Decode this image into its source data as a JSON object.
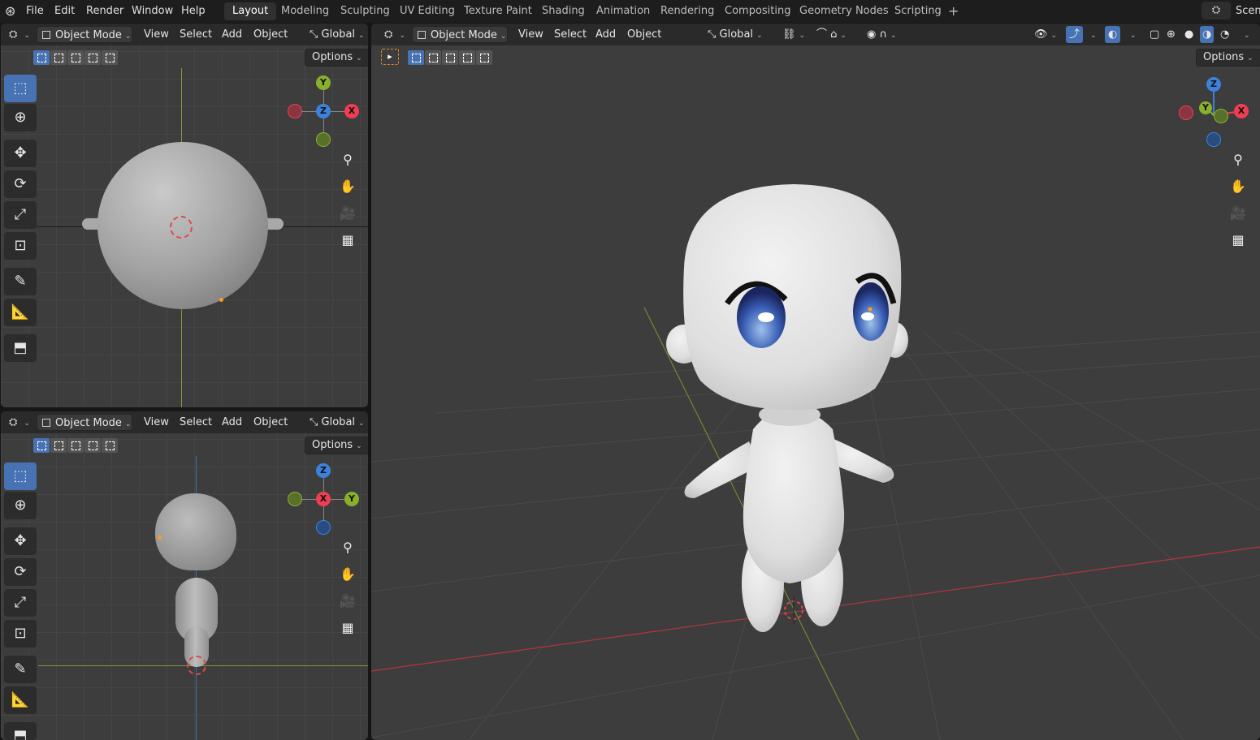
{
  "topbar": {
    "menus": [
      "File",
      "Edit",
      "Render",
      "Window",
      "Help"
    ],
    "workspaces": [
      "Layout",
      "Modeling",
      "Sculpting",
      "UV Editing",
      "Texture Paint",
      "Shading",
      "Animation",
      "Rendering",
      "Compositing",
      "Geometry Nodes",
      "Scripting"
    ],
    "active_workspace": "Layout",
    "add_tab": "+",
    "scene_label": "Scen"
  },
  "viewport_header": {
    "mode": "Object Mode",
    "menus": [
      "View",
      "Select",
      "Add",
      "Object"
    ],
    "orientation": "Global",
    "options": "Options"
  },
  "views": {
    "top_left": {
      "axes": {
        "y": "Y",
        "z": "Z",
        "x": "X"
      }
    },
    "bottom_left": {
      "axes": {
        "z": "Z",
        "x": "X",
        "y": "Y"
      }
    },
    "main": {
      "axes": {
        "z": "Z",
        "y": "Y",
        "x": "X"
      }
    }
  },
  "colors": {
    "accent_blue": "#4772b3",
    "axis_x": "#ee3f52",
    "axis_y": "#8ab02b",
    "axis_z": "#3c82dc",
    "cursor_red": "#e64545",
    "origin_orange": "#ff9b20"
  },
  "icons": {
    "tools": [
      "select-box-icon",
      "cursor-icon",
      "move-icon",
      "rotate-icon",
      "scale-icon",
      "transform-icon",
      "annotate-icon",
      "measure-icon",
      "add-cube-icon"
    ],
    "nav": [
      "zoom-icon",
      "pan-hand-icon",
      "camera-icon",
      "grid-icon"
    ]
  }
}
